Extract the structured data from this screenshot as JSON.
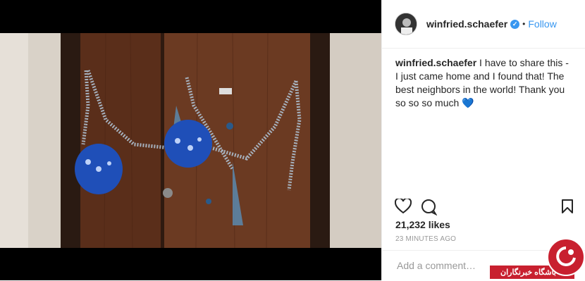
{
  "post": {
    "username": "winfried.schaefer",
    "verified_icon": "check-icon",
    "separator": "•",
    "follow_label": "Follow",
    "caption_user": "winfried.schaefer",
    "caption_text": " I have to share this - I just came home and I found that! The best neighbors in the world! Thank you so so so much ",
    "caption_emoji": "💙",
    "likes": "21,232 likes",
    "time": "23 MINUTES AGO",
    "comment_placeholder": "Add a comment…"
  },
  "actions": {
    "like_icon": "heart-icon",
    "comment_icon": "comment-icon",
    "save_icon": "bookmark-icon"
  },
  "watermark": {
    "text": "باشگاه خبرنگاران"
  },
  "colors": {
    "accent": "#3897f0",
    "watermark": "#c8202f",
    "door": "#5a2e1a"
  }
}
